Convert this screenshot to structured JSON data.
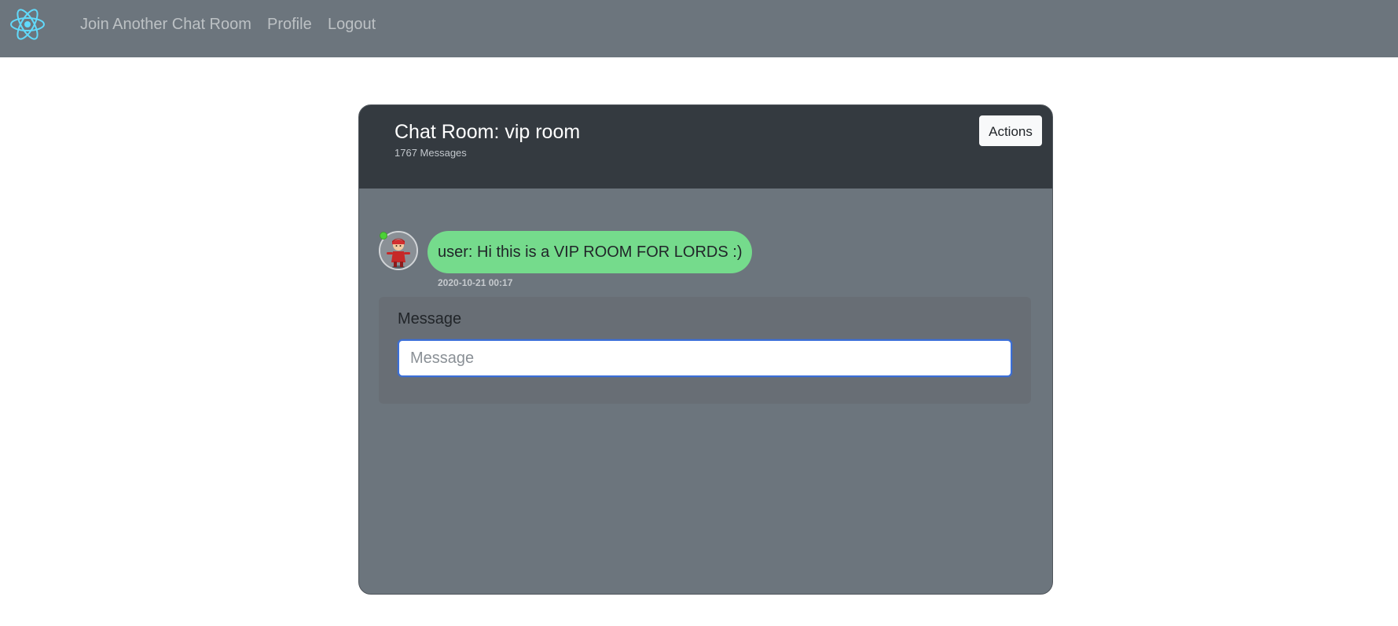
{
  "navbar": {
    "logo_icon": "react-atom-icon",
    "links": {
      "join": "Join Another Chat Room",
      "profile": "Profile",
      "logout": "Logout"
    }
  },
  "chat": {
    "title": "Chat Room: vip room",
    "message_count": "1767 Messages",
    "actions_label": "Actions",
    "messages": [
      {
        "text": "user: Hi this is a VIP ROOM FOR LORDS :)",
        "timestamp": "2020-10-21 00:17",
        "avatar_icon": "avatar-icon",
        "online": true
      }
    ],
    "form": {
      "label": "Message",
      "placeholder": "Message",
      "value": ""
    }
  },
  "colors": {
    "navbar_bg": "#6c757d",
    "header_bg": "#343a40",
    "card_bg": "#6c757d",
    "bubble_bg": "#75db8c",
    "online_dot": "#4cd137",
    "focus_border": "#3b6fd8",
    "logo": "#61dafb"
  }
}
